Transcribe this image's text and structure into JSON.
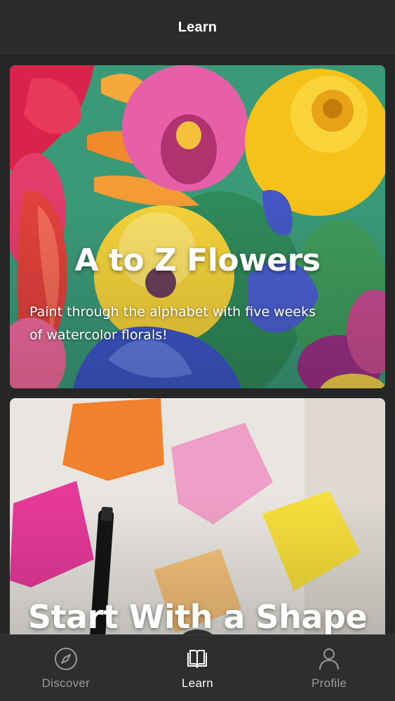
{
  "header": {
    "title": "Learn"
  },
  "cards": [
    {
      "title": "A to Z Flowers",
      "description": "Paint through the alphabet with five weeks of watercolor florals!"
    },
    {
      "title": "Start With a Shape"
    }
  ],
  "tabs": [
    {
      "label": "Discover",
      "icon": "compass-icon",
      "active": false
    },
    {
      "label": "Learn",
      "icon": "book-icon",
      "active": true
    },
    {
      "label": "Profile",
      "icon": "person-icon",
      "active": false
    }
  ],
  "colors": {
    "background": "#262626",
    "header": "#2b2b2b",
    "tabbar": "#2e2e2e",
    "tab_inactive": "#9a9a9a",
    "tab_active": "#ffffff"
  }
}
